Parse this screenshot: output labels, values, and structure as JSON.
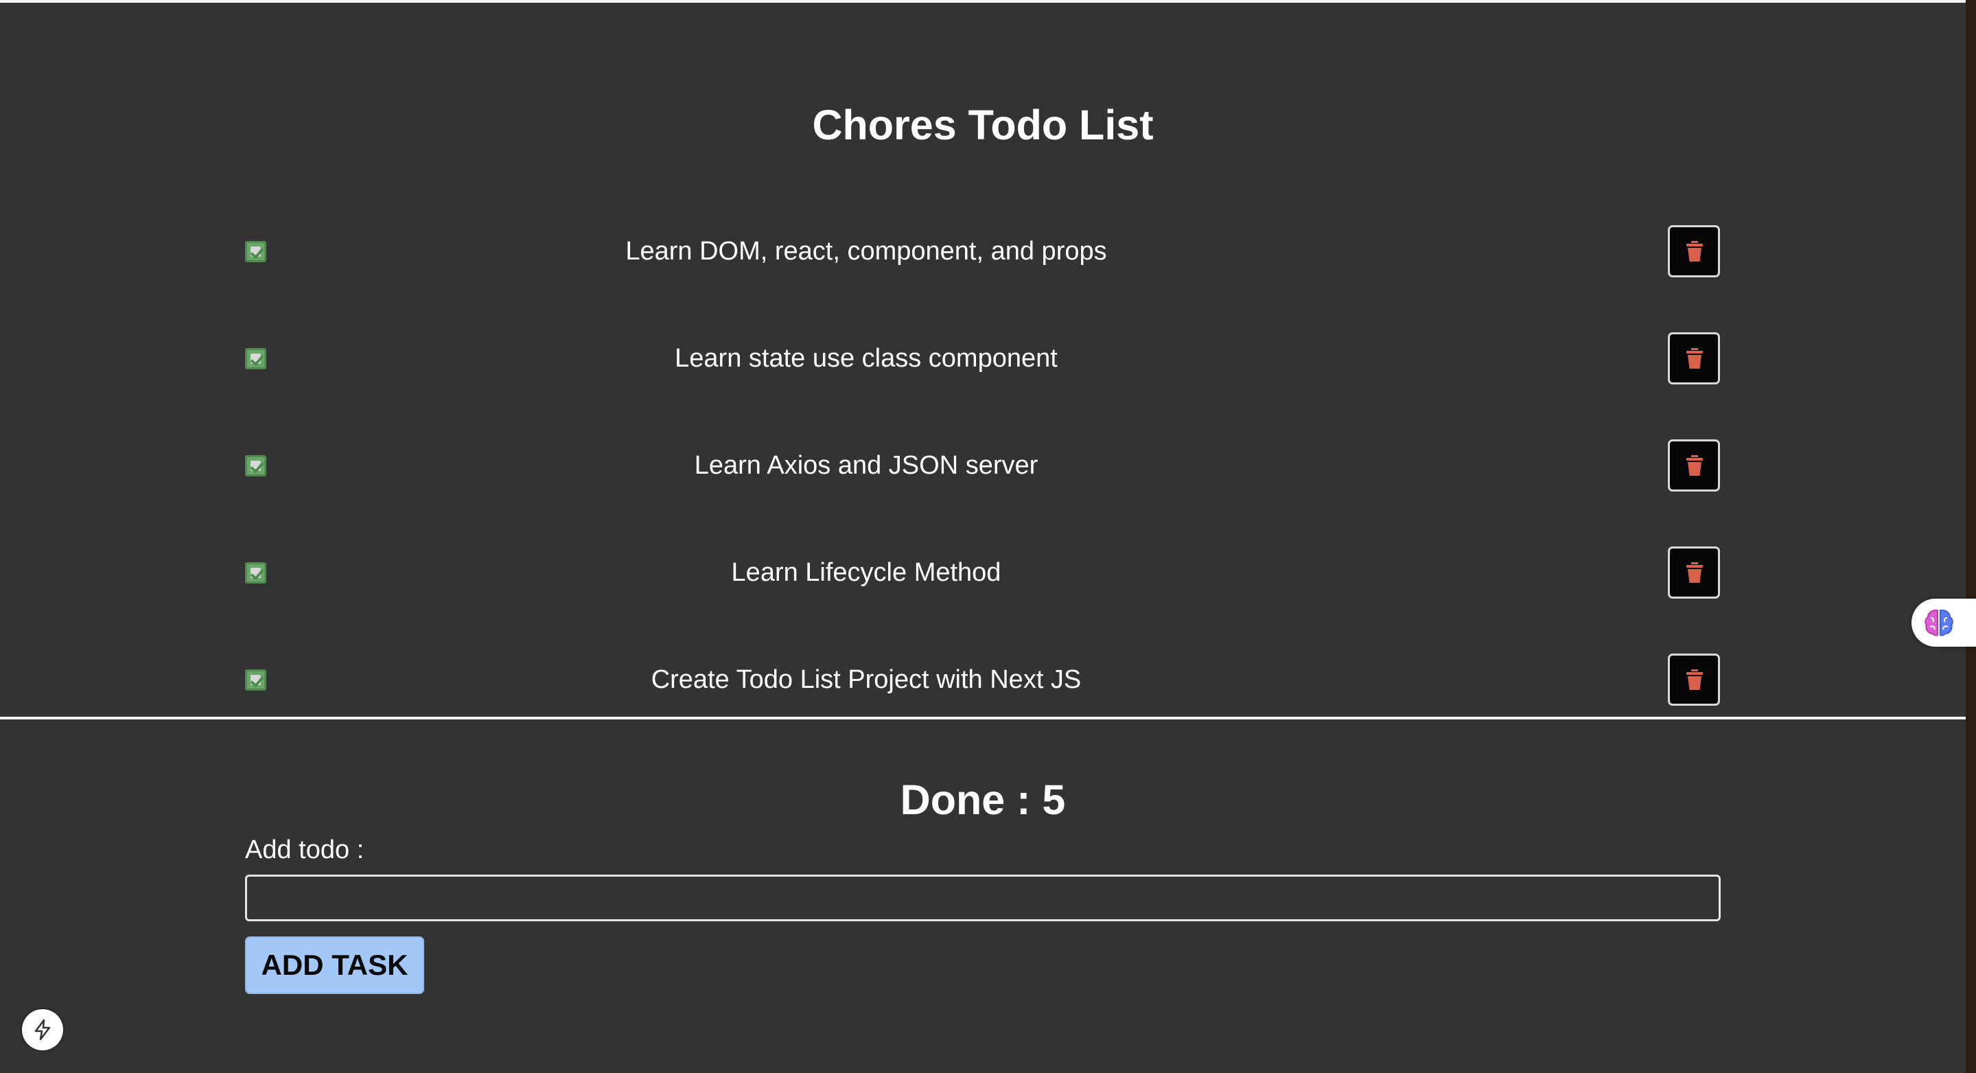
{
  "page": {
    "title": "Chores Todo List"
  },
  "todos": [
    {
      "text": "Learn DOM, react, component, and props",
      "done": true
    },
    {
      "text": "Learn state use class component",
      "done": true
    },
    {
      "text": "Learn Axios and JSON server",
      "done": true
    },
    {
      "text": "Learn Lifecycle Method",
      "done": true
    },
    {
      "text": "Create Todo List Project with Next JS",
      "done": true
    }
  ],
  "summary": {
    "done_label": "Done",
    "separator": " : ",
    "done_count": "5"
  },
  "form": {
    "label": "Add todo :",
    "input_value": "",
    "button_label": "ADD TASK"
  },
  "icons": {
    "delete": "trash-icon",
    "checkbox": "checkbox-checked-icon",
    "extension": "brain-icon",
    "dev_indicator": "lightning-bolt-icon"
  },
  "colors": {
    "background": "#333333",
    "text": "#ffffff",
    "checkbox": "#6aa56a",
    "trash": "#d9604a",
    "delete_button_bg": "#050505",
    "add_button_bg": "#a3c7f7"
  }
}
